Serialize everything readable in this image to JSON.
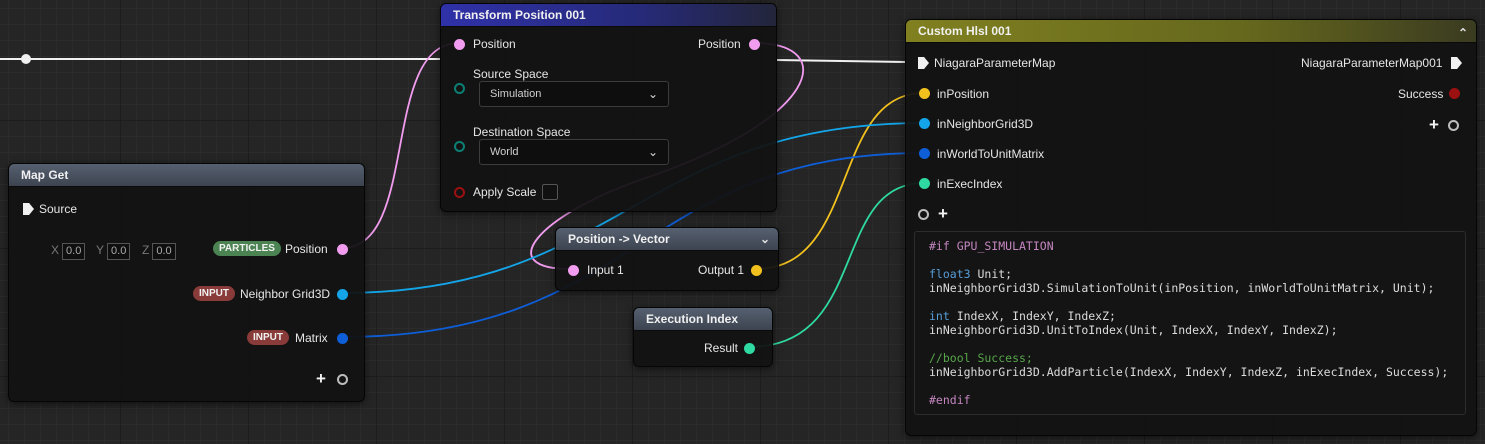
{
  "nodes": {
    "map_get": {
      "title": "Map Get",
      "source_label": "Source",
      "vector_default": {
        "x_label": "X",
        "x": "0.0",
        "y_label": "Y",
        "y": "0.0",
        "z_label": "Z",
        "z": "0.0"
      },
      "outputs": [
        {
          "badge": "PARTICLES",
          "label": "Position"
        },
        {
          "badge": "INPUT",
          "label": "Neighbor Grid3D"
        },
        {
          "badge": "INPUT",
          "label": "Matrix"
        }
      ]
    },
    "transform_position": {
      "title": "Transform Position 001",
      "input_label": "Position",
      "output_label": "Position",
      "source_space_label": "Source Space",
      "source_space_value": "Simulation",
      "destination_space_label": "Destination Space",
      "destination_space_value": "World",
      "apply_scale_label": "Apply Scale"
    },
    "position_to_vector": {
      "title": "Position -> Vector",
      "input_label": "Input 1",
      "output_label": "Output 1"
    },
    "execution_index": {
      "title": "Execution Index",
      "output_label": "Result"
    },
    "custom_hlsl": {
      "title": "Custom Hlsl 001",
      "exec_in_label": "NiagaraParameterMap",
      "exec_out_label": "NiagaraParameterMap001",
      "inputs": [
        "inPosition",
        "inNeighborGrid3D",
        "inWorldToUnitMatrix",
        "inExecIndex"
      ],
      "output_success": "Success",
      "code": [
        [
          {
            "t": "#if GPU_SIMULATION",
            "c": "pp"
          }
        ],
        [],
        [
          {
            "t": "float3",
            "c": "kw"
          },
          {
            "t": " Unit;",
            "c": "tx"
          }
        ],
        [
          {
            "t": "inNeighborGrid3D.SimulationToUnit(inPosition, inWorldToUnitMatrix, Unit);",
            "c": "tx"
          }
        ],
        [],
        [
          {
            "t": "int",
            "c": "kw"
          },
          {
            "t": " IndexX, IndexY, IndexZ;",
            "c": "tx"
          }
        ],
        [
          {
            "t": "inNeighborGrid3D.UnitToIndex(Unit, IndexX, IndexY, IndexZ);",
            "c": "tx"
          }
        ],
        [],
        [
          {
            "t": "//bool Success;",
            "c": "cm"
          }
        ],
        [
          {
            "t": "inNeighborGrid3D.AddParticle(IndexX, IndexY, IndexZ, inExecIndex, Success);",
            "c": "tx"
          }
        ],
        [],
        [
          {
            "t": "#endif",
            "c": "pp"
          }
        ]
      ]
    }
  },
  "icons": {
    "collapse": "chevron-down",
    "collapse_up": "chevron-up",
    "add_pin": "+"
  },
  "colors": {
    "position_pin": "#f29cf0",
    "vector_pin": "#f2c11e",
    "grid_pin": "#13a5e8",
    "matrix_pin": "#0e5ed8",
    "int_pin": "#2fd9a2",
    "bool_pin": "#9b1010",
    "enum_pin": "#0c7f74",
    "exec_pin": "#f0f0f0"
  }
}
